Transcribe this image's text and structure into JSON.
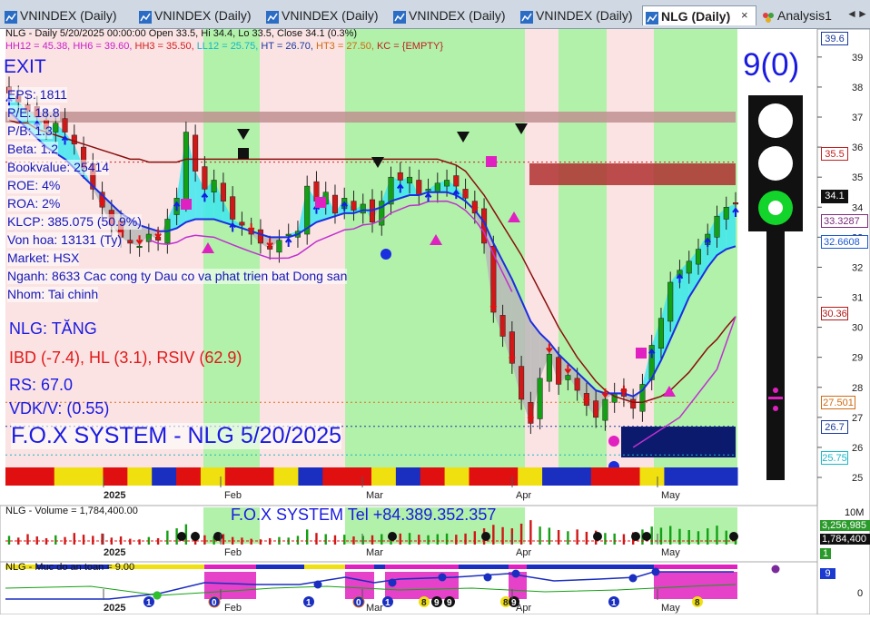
{
  "tabs": [
    {
      "label": "VNINDEX (Daily)",
      "active": false
    },
    {
      "label": "VNINDEX (Daily)",
      "active": false
    },
    {
      "label": "VNINDEX (Daily)",
      "active": false
    },
    {
      "label": "VNINDEX (Daily)",
      "active": false
    },
    {
      "label": "VNINDEX (Daily)",
      "active": false
    },
    {
      "label": "NLG (Daily)",
      "active": true
    },
    {
      "label": "Analysis1",
      "active": false
    }
  ],
  "tab_close": "×",
  "tab_nav_left": "◄",
  "tab_nav_right": "►",
  "header": {
    "line1": "NLG - Daily 5/20/2025 00:00:00 Open 33.5, Hi 34.4, Lo 33.5, Close 34.1 (0.3%)",
    "hh12": "HH12 = 45.38,",
    "hh6": "HH6 = 39.60,",
    "hh3": "HH3 = 35.50,",
    "ll12": "LL12 = 25.75,",
    "ht": "HT  = 26.70,",
    "ht3": "HT3  = 27.50,",
    "kc": "KC = {EMPTY}"
  },
  "signal_exit": "EXIT",
  "info_lines": [
    "EPS: 1811",
    "P/E: 18.8",
    "P/B: 1.3",
    "Beta: 1.2",
    "Bookvalue: 25414",
    "ROE: 4%",
    "ROA: 2%",
    "KLCP: 385.075 (50.9%)",
    "Von hoa: 13131 (Ty)",
    "Market: HSX",
    "Nganh: 8633 Cac cong ty Dau co va phat trien bat Dong san",
    "Nhom: Tai chinh"
  ],
  "status": {
    "trend": "NLG: TĂNG",
    "ibd": "IBD (-7.4), HL (3.1), RSIV (62.9)",
    "rs": "RS: 67.0",
    "vdk": "VDK/V:  (0.55)",
    "banner": "F.O.X SYSTEM - NLG 5/20/2025"
  },
  "score": "9(0)",
  "price_axis": [
    "39",
    "38",
    "37",
    "36",
    "35",
    "34",
    "33",
    "32",
    "31",
    "30",
    "29",
    "28",
    "27",
    "26",
    "25"
  ],
  "price_labels": [
    {
      "text": "39.6",
      "color": "#1a3aa0"
    },
    {
      "text": "35.5",
      "color": "#c02020"
    },
    {
      "text": "34.1",
      "color": "#ffffff"
    },
    {
      "text": "33.3287",
      "color": "#7a2a7a"
    },
    {
      "text": "32.6608",
      "color": "#1a5ad0"
    },
    {
      "text": "30.36",
      "color": "#b01a1a"
    },
    {
      "text": "27.501",
      "color": "#d06a10"
    },
    {
      "text": "26.7",
      "color": "#1a3aa0"
    },
    {
      "text": "25.75",
      "color": "#19b8c8"
    }
  ],
  "month_labels": [
    "2025",
    "Feb",
    "Mar",
    "Apr",
    "May"
  ],
  "volume": {
    "title": "NLG - Volume = 1,784,400.00",
    "tel": "F.O.X SYSTEM Tel +84.389.352.357",
    "axis_top": "10M",
    "last_value": "3,256,985",
    "current": "1,784,400",
    "small_box": "1"
  },
  "safety": {
    "title": "NLG - Muc do an toan = 9.00",
    "value_label": "9",
    "axis_zero": "0",
    "circle_digits": [
      "1",
      "0",
      "1",
      "0",
      "1",
      "8",
      "9",
      "9",
      "8",
      "9",
      "1",
      "8"
    ]
  },
  "chart_data": {
    "type": "candlestick",
    "symbol": "NLG",
    "timeframe": "Daily",
    "date": "5/20/2025",
    "ohlc_last": {
      "open": 33.5,
      "high": 34.4,
      "low": 33.5,
      "close": 34.1,
      "change_pct": 0.3
    },
    "ylim": [
      25,
      39.6
    ],
    "levels": {
      "HH12": 45.38,
      "HH6": 39.6,
      "HH3": 35.5,
      "LL12": 25.75,
      "HT": 26.7,
      "HT3": 27.5
    },
    "closes": [
      37.8,
      37.5,
      37.2,
      37.0,
      36.6,
      36.8,
      36.5,
      36.1,
      35.3,
      34.6,
      34.0,
      33.4,
      33.0,
      32.8,
      32.7,
      33.1,
      32.9,
      33.6,
      34.3,
      36.5,
      35.2,
      34.6,
      34.9,
      34.2,
      33.6,
      33.4,
      33.1,
      32.8,
      32.6,
      32.9,
      33.1,
      33.2,
      34.7,
      34.2,
      34.5,
      33.8,
      34.3,
      33.9,
      34.1,
      33.5,
      34.2,
      35.0,
      34.9,
      35.0,
      34.4,
      34.6,
      34.8,
      34.9,
      34.7,
      34.3,
      33.8,
      32.8,
      30.5,
      29.7,
      28.8,
      27.6,
      26.8,
      28.3,
      29.1,
      28.1,
      28.4,
      27.9,
      27.4,
      27.0,
      27.6,
      27.8,
      27.7,
      27.3,
      28.1,
      29.4,
      30.3,
      31.5,
      31.9,
      32.2,
      32.6,
      33.1,
      33.7,
      34.0,
      34.1
    ],
    "ma_blue": [
      37.2,
      36.9,
      36.6,
      36.3,
      36.0,
      35.8,
      35.6,
      35.3,
      35.0,
      34.7,
      34.4,
      34.1,
      33.8,
      33.6,
      33.4,
      33.3,
      33.2,
      33.2,
      33.3,
      33.5,
      33.6,
      33.6,
      33.6,
      33.5,
      33.4,
      33.3,
      33.2,
      33.1,
      33.0,
      33.0,
      33.0,
      33.1,
      33.3,
      33.5,
      33.6,
      33.7,
      33.8,
      33.8,
      33.9,
      33.9,
      34.0,
      34.2,
      34.3,
      34.4,
      34.4,
      34.5,
      34.5,
      34.5,
      34.4,
      34.2,
      33.9,
      33.5,
      32.8,
      32.2,
      31.6,
      30.9,
      30.2,
      29.8,
      29.5,
      29.1,
      28.8,
      28.5,
      28.2,
      27.9,
      27.8,
      27.8,
      27.8,
      27.7,
      27.9,
      28.3,
      28.9,
      29.6,
      30.3,
      31.0,
      31.5,
      32.0,
      32.4,
      32.6,
      32.7
    ],
    "ma_red": [
      36.9,
      36.8,
      36.8,
      36.6,
      36.5,
      36.4,
      36.3,
      36.2,
      36.1,
      36.0,
      35.9,
      35.8,
      35.7,
      35.6,
      35.6,
      35.5,
      35.5,
      35.5,
      35.5,
      35.6,
      35.6,
      35.6,
      35.6,
      35.6,
      35.6,
      35.6,
      35.6,
      35.6,
      35.6,
      35.6,
      35.6,
      35.6,
      35.6,
      35.6,
      35.6,
      35.6,
      35.6,
      35.6,
      35.6,
      35.6,
      35.6,
      35.6,
      35.6,
      35.6,
      35.6,
      35.6,
      35.6,
      35.5,
      35.4,
      35.2,
      34.8,
      34.4,
      33.9,
      33.4,
      32.9,
      32.4,
      31.8,
      31.2,
      30.6,
      30.0,
      29.5,
      29.0,
      28.6,
      28.2,
      27.9,
      27.7,
      27.6,
      27.5,
      27.5,
      27.6,
      27.7,
      27.9,
      28.2,
      28.5,
      28.9,
      29.3,
      29.6,
      30.0,
      30.36
    ],
    "volume_values": [
      1.5,
      1.2,
      1.8,
      1.4,
      1.1,
      1.6,
      1.3,
      2.0,
      1.7,
      1.5,
      1.9,
      1.2,
      1.4,
      1.0,
      0.9,
      1.3,
      1.1,
      2.4,
      2.8,
      3.5,
      2.2,
      1.6,
      1.4,
      1.8,
      1.3,
      1.2,
      1.0,
      0.9,
      1.1,
      1.3,
      1.2,
      1.5,
      2.6,
      2.0,
      1.8,
      1.6,
      1.7,
      1.4,
      1.5,
      1.6,
      1.8,
      2.1,
      1.9,
      2.0,
      1.7,
      1.6,
      1.8,
      1.9,
      1.7,
      1.9,
      2.3,
      2.8,
      3.4,
      3.0,
      2.8,
      3.6,
      4.2,
      3.1,
      2.9,
      2.5,
      2.3,
      2.6,
      2.2,
      2.4,
      2.0,
      1.9,
      1.8,
      2.1,
      2.6,
      3.1,
      2.9,
      3.2,
      2.7,
      2.5,
      2.3,
      2.8,
      3.256985,
      2.4,
      1.7844
    ],
    "volume_unit": "M",
    "safety_value": 9
  }
}
